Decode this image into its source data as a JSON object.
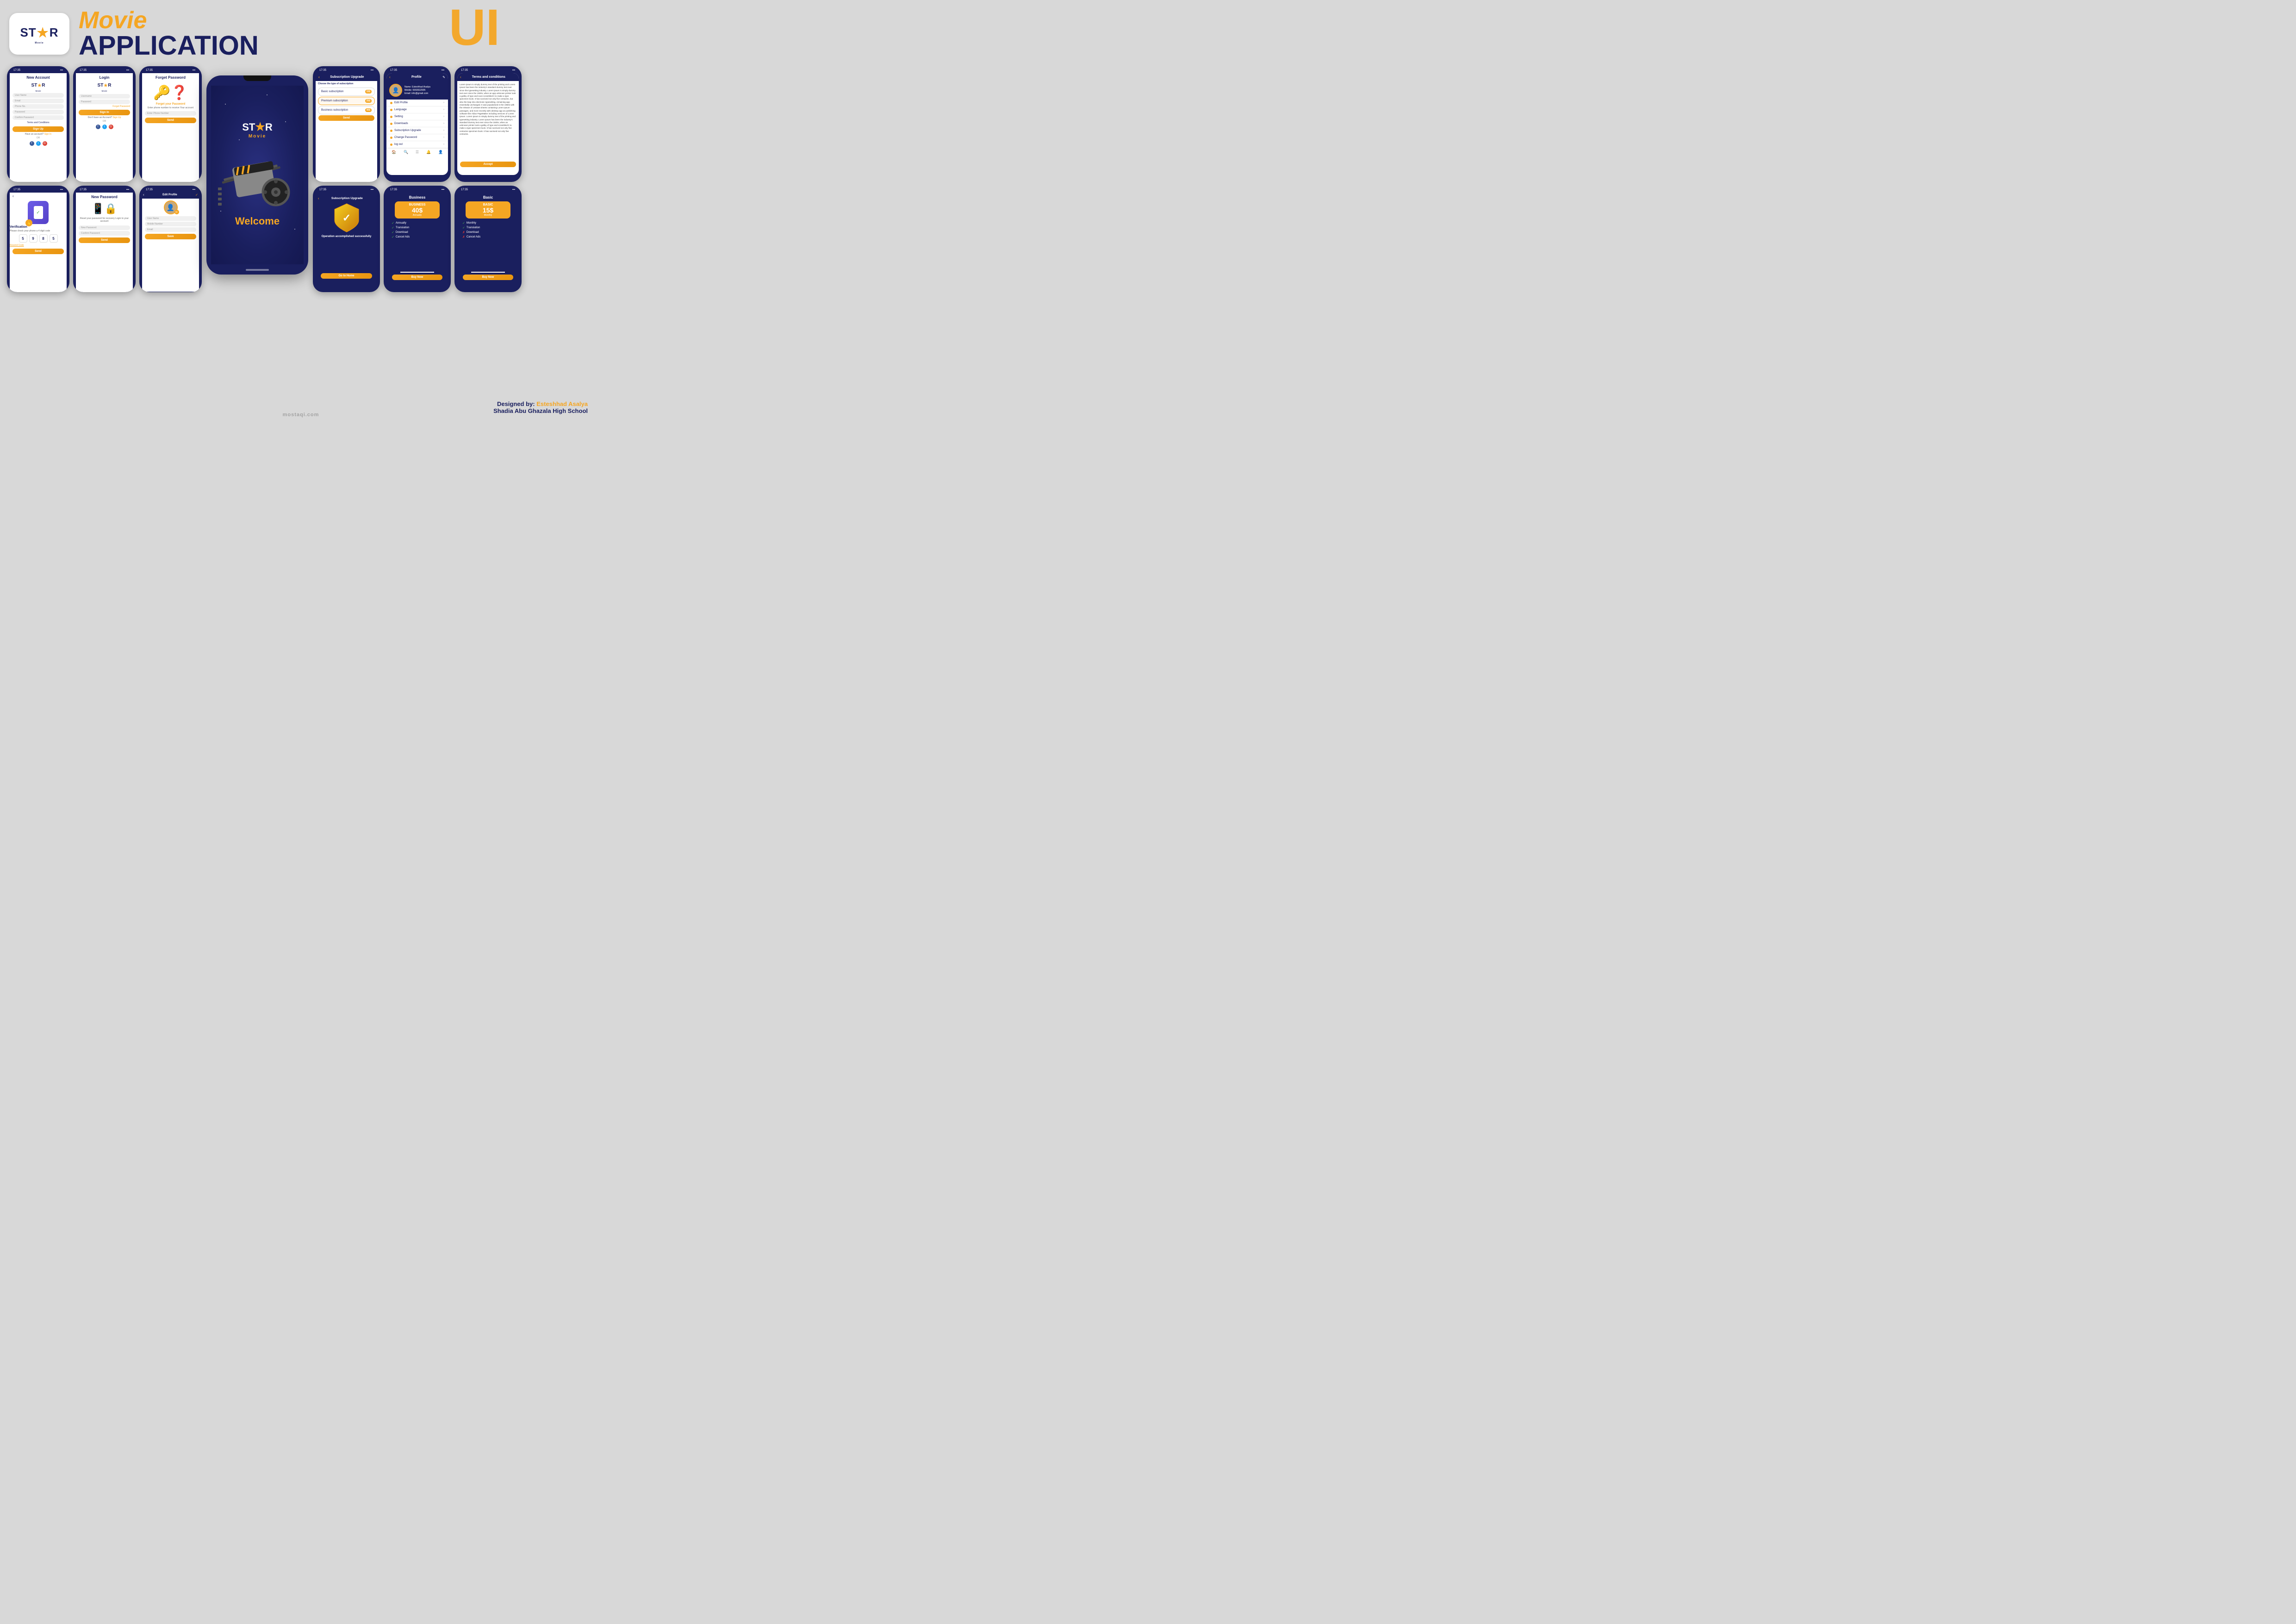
{
  "app": {
    "name": "Star Movie",
    "tagline": "Movie APPLICATION UI"
  },
  "header": {
    "logo_text": "ST★R",
    "logo_sub": "Movie",
    "title_movie": "Movie",
    "title_application": "APPLICATION",
    "title_ui": "UI"
  },
  "screens": {
    "new_account": {
      "title": "New Account",
      "fields": [
        "User Name",
        "Email",
        "Phone No.",
        "Password",
        "Confirm Password"
      ],
      "terms": "Terms and Conditions",
      "signup_btn": "Sign Up",
      "signin_hint": "Have an account? Sign In",
      "or": "OR"
    },
    "login": {
      "title": "Login",
      "fields": [
        "Username",
        "Password"
      ],
      "forgot": "Forget Password",
      "signin_btn": "Sign In",
      "no_account": "Don't have an Account? Sign Up",
      "or": "OR"
    },
    "forget_password": {
      "title": "Forget Password",
      "subtitle": "Forget your Password",
      "description": "Enter phone number to receive Your account",
      "field": "Enter Phone Number",
      "btn": "Send"
    },
    "verification": {
      "title": "Verification",
      "subtitle": "Please check your phone a 4 digit code",
      "codes": [
        "5",
        "9",
        "8",
        "5"
      ],
      "resend": "Resend Code",
      "btn": "Send"
    },
    "new_password": {
      "title": "New Password",
      "description": "Reset your password for recovery Login to your account",
      "fields": [
        "New Password",
        "Confirm Password"
      ],
      "btn": "Send"
    },
    "edit_profile": {
      "title": "Edit Profile",
      "fields": [
        "User Name",
        "Mobile Number",
        "Email"
      ],
      "btn": "Save"
    },
    "profile": {
      "title": "Profile",
      "user": {
        "name": "Name: Esteshhad Asalya",
        "mobile": "Mobile: 5993532905",
        "email": "Email: info@gmail.com"
      },
      "menu": [
        "Edit Profile",
        "Language",
        "Setting",
        "Downloads",
        "Subscription Upgrade",
        "Change Password",
        "log out"
      ]
    },
    "subscription_upgrade": {
      "title": "Subscription Upgrade",
      "subtitle": "Choose the type of subscription",
      "options": [
        {
          "name": "Basic subscription",
          "price": "15$"
        },
        {
          "name": "Premium subscription",
          "price": "25$"
        },
        {
          "name": "Business subscription",
          "price": "40$"
        }
      ],
      "btn": "Send"
    },
    "terms": {
      "title": "Terms and conditions",
      "text": "Lorem ipsum is simply dummy text of the printing and Lorem Ipsum has been the industry's standard dummy text ever since the typesetting industry. Lorem ipsum is simply dummy text ever since the 1500s, when an app unknown printer took a galley of type and soon scrambled it to make a type specimen book. It has survived not only five centuries, but also the leap into electronic typesetting, remaining app essentially unchanged. It was popularised in the 1960s with the release of Letraset sheets containing Lorem Ipsum passages, and more recently with desktop app an publishing software like Aldus PageMaker including versions of Lorem Ipsum. Lorem ipsum is simply dummy text of the printing and typesetting industry. Lorem Ipsum has been the industry's standard dummy text ever since the 1500s, when an unknown printer took a galley of type and scrambled it to make a type specimen book. It has survived not only five centuries specimen book. It has survived not only five centuries.",
      "btn": "Accept"
    },
    "sub_success": {
      "title": "Subscription Upgrade",
      "message": "Operation accomplished successfully",
      "btn": "Go to Home"
    },
    "business_plan": {
      "title": "Business",
      "plan_name": "BUSINESS",
      "price": "40$",
      "period": "Annually",
      "features": [
        {
          "name": "Annually",
          "available": true
        },
        {
          "name": "Translation",
          "available": true
        },
        {
          "name": "Download",
          "available": true
        },
        {
          "name": "Cancel Ads",
          "available": true
        }
      ],
      "btn": "Buy Now"
    },
    "basic_plan": {
      "title": "Basic",
      "plan_name": "BASIC",
      "price": "15$",
      "period": "Monthly",
      "features": [
        {
          "name": "Monthly",
          "available": true
        },
        {
          "name": "Translation",
          "available": true
        },
        {
          "name": "Download",
          "available": false
        },
        {
          "name": "Cancel Ads",
          "available": false
        }
      ],
      "btn": "Buy Now"
    }
  },
  "welcome": {
    "text": "Welcome"
  },
  "designer": {
    "label": "Designed by:",
    "name": "Esteshhad Asalya",
    "school": "Shadia Abu Ghazala High School"
  },
  "watermark": "mostaqi.com"
}
